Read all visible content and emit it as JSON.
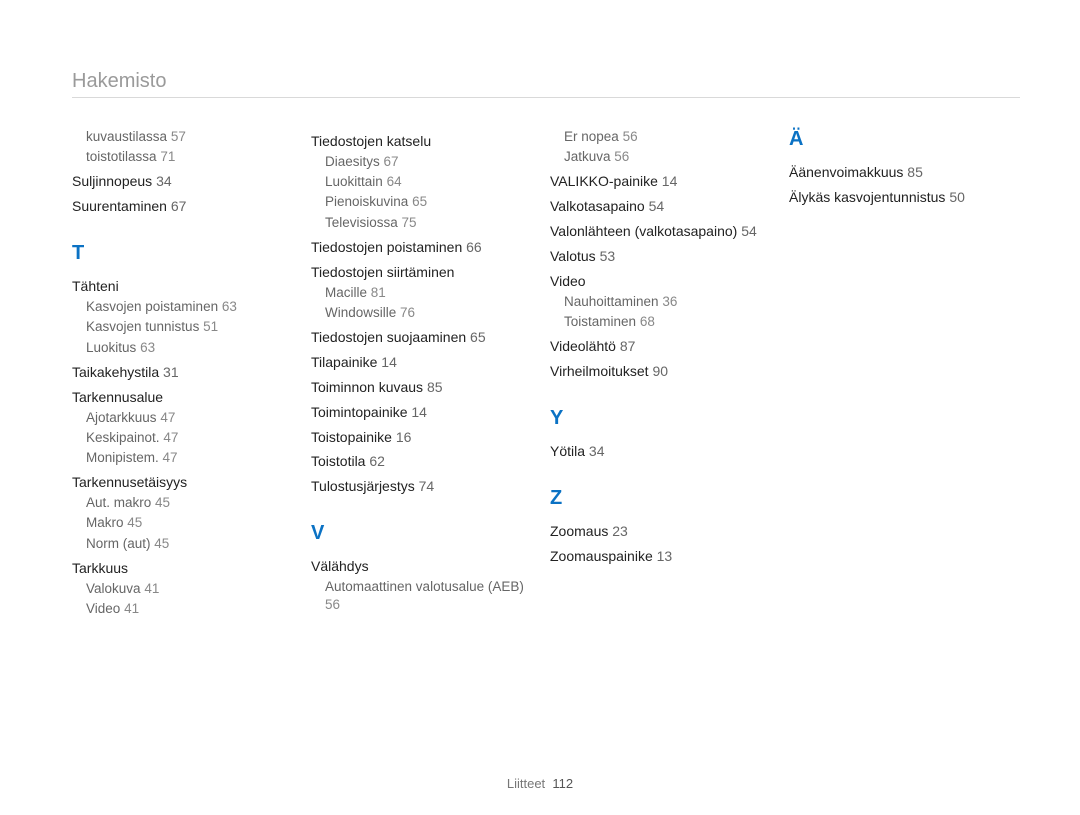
{
  "page_title": "Hakemisto",
  "footer": {
    "label": "Liitteet",
    "page": "112"
  },
  "columns": [
    {
      "blocks": [
        {
          "type": "sub",
          "text": "kuvaustilassa",
          "page": "57"
        },
        {
          "type": "sub",
          "text": "toistotilassa",
          "page": "71"
        },
        {
          "type": "entry",
          "text": "Suljinnopeus",
          "page": "34"
        },
        {
          "type": "entry",
          "text": "Suurentaminen",
          "page": "67"
        },
        {
          "type": "letter",
          "text": "T"
        },
        {
          "type": "group",
          "text": "Tähteni"
        },
        {
          "type": "sub",
          "text": "Kasvojen poistaminen",
          "page": "63"
        },
        {
          "type": "sub",
          "text": "Kasvojen tunnistus",
          "page": "51"
        },
        {
          "type": "sub",
          "text": "Luokitus",
          "page": "63"
        },
        {
          "type": "entry",
          "text": "Taikakehystila",
          "page": "31"
        },
        {
          "type": "group",
          "text": "Tarkennusalue"
        },
        {
          "type": "sub",
          "text": "Ajotarkkuus",
          "page": "47"
        },
        {
          "type": "sub",
          "text": "Keskipainot.",
          "page": "47"
        },
        {
          "type": "sub",
          "text": "Monipistem.",
          "page": "47"
        },
        {
          "type": "group",
          "text": "Tarkennusetäisyys"
        },
        {
          "type": "sub",
          "text": "Aut. makro",
          "page": "45"
        },
        {
          "type": "sub",
          "text": "Makro",
          "page": "45"
        },
        {
          "type": "sub",
          "text": "Norm (aut)",
          "page": "45"
        },
        {
          "type": "group",
          "text": "Tarkkuus"
        },
        {
          "type": "sub",
          "text": "Valokuva",
          "page": "41"
        },
        {
          "type": "sub",
          "text": "Video",
          "page": "41"
        }
      ]
    },
    {
      "blocks": [
        {
          "type": "group",
          "text": "Tiedostojen katselu"
        },
        {
          "type": "sub",
          "text": "Diaesitys",
          "page": "67"
        },
        {
          "type": "sub",
          "text": "Luokittain",
          "page": "64"
        },
        {
          "type": "sub",
          "text": "Pienoiskuvina",
          "page": "65"
        },
        {
          "type": "sub",
          "text": "Televisiossa",
          "page": "75"
        },
        {
          "type": "entry",
          "text": "Tiedostojen poistaminen",
          "page": "66"
        },
        {
          "type": "group",
          "text": "Tiedostojen siirtäminen"
        },
        {
          "type": "sub",
          "text": "Macille",
          "page": "81"
        },
        {
          "type": "sub",
          "text": "Windowsille",
          "page": "76"
        },
        {
          "type": "entry",
          "text": "Tiedostojen suojaaminen",
          "page": "65"
        },
        {
          "type": "entry",
          "text": "Tilapainike",
          "page": "14"
        },
        {
          "type": "entry",
          "text": "Toiminnon kuvaus",
          "page": "85"
        },
        {
          "type": "entry",
          "text": "Toimintopainike",
          "page": "14"
        },
        {
          "type": "entry",
          "text": "Toistopainike",
          "page": "16"
        },
        {
          "type": "entry",
          "text": "Toistotila",
          "page": "62"
        },
        {
          "type": "entry",
          "text": "Tulostusjärjestys",
          "page": "74"
        },
        {
          "type": "letter",
          "text": "V"
        },
        {
          "type": "group",
          "text": "Välähdys"
        },
        {
          "type": "sub",
          "text": "Automaattinen valotusalue (AEB)",
          "page": "56"
        }
      ]
    },
    {
      "blocks": [
        {
          "type": "sub",
          "text": "Er nopea",
          "page": "56"
        },
        {
          "type": "sub",
          "text": "Jatkuva",
          "page": "56"
        },
        {
          "type": "entry",
          "text": "VALIKKO-painike",
          "page": "14"
        },
        {
          "type": "entry",
          "text": "Valkotasapaino",
          "page": "54"
        },
        {
          "type": "entry",
          "text": "Valonlähteen (valkotasapaino)",
          "page": "54"
        },
        {
          "type": "entry",
          "text": "Valotus",
          "page": "53"
        },
        {
          "type": "group",
          "text": "Video"
        },
        {
          "type": "sub",
          "text": "Nauhoittaminen",
          "page": "36"
        },
        {
          "type": "sub",
          "text": "Toistaminen",
          "page": "68"
        },
        {
          "type": "entry",
          "text": "Videolähtö",
          "page": "87"
        },
        {
          "type": "entry",
          "text": "Virheilmoitukset",
          "page": "90"
        },
        {
          "type": "letter",
          "text": "Y"
        },
        {
          "type": "entry",
          "text": "Yötila",
          "page": "34"
        },
        {
          "type": "letter",
          "text": "Z"
        },
        {
          "type": "entry",
          "text": "Zoomaus",
          "page": "23"
        },
        {
          "type": "entry",
          "text": "Zoomauspainike",
          "page": "13"
        }
      ]
    },
    {
      "blocks": [
        {
          "type": "letter_top",
          "text": "Ä"
        },
        {
          "type": "entry",
          "text": "Äänenvoimakkuus",
          "page": "85"
        },
        {
          "type": "entry",
          "text": "Älykäs kasvojentunnistus",
          "page": "50"
        }
      ]
    }
  ]
}
